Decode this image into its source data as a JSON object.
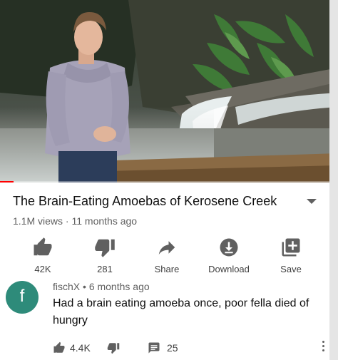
{
  "video": {
    "title": "The Brain-Eating Amoebas of Kerosene Creek",
    "views": "1.1M views",
    "age": "11 months ago",
    "meta_separator": "·",
    "progress": 0.04,
    "thumbnail_scene": "presenter-by-waterfall"
  },
  "actions": [
    {
      "icon": "thumb-up-icon",
      "label": "42K"
    },
    {
      "icon": "thumb-down-icon",
      "label": "281"
    },
    {
      "icon": "share-icon",
      "label": "Share"
    },
    {
      "icon": "download-icon",
      "label": "Download"
    },
    {
      "icon": "save-playlist-icon",
      "label": "Save"
    }
  ],
  "comment": {
    "avatar_letter": "f",
    "avatar_color": "#2e8b7a",
    "author": "fischX",
    "separator": "•",
    "age": "6 months ago",
    "text": "Had a brain eating amoeba once, poor fella died of hungry",
    "likes": "4.4K",
    "replies": "25"
  },
  "colors": {
    "progress": "#ff0000",
    "icon": "#606060",
    "secondary_text": "#606060"
  }
}
